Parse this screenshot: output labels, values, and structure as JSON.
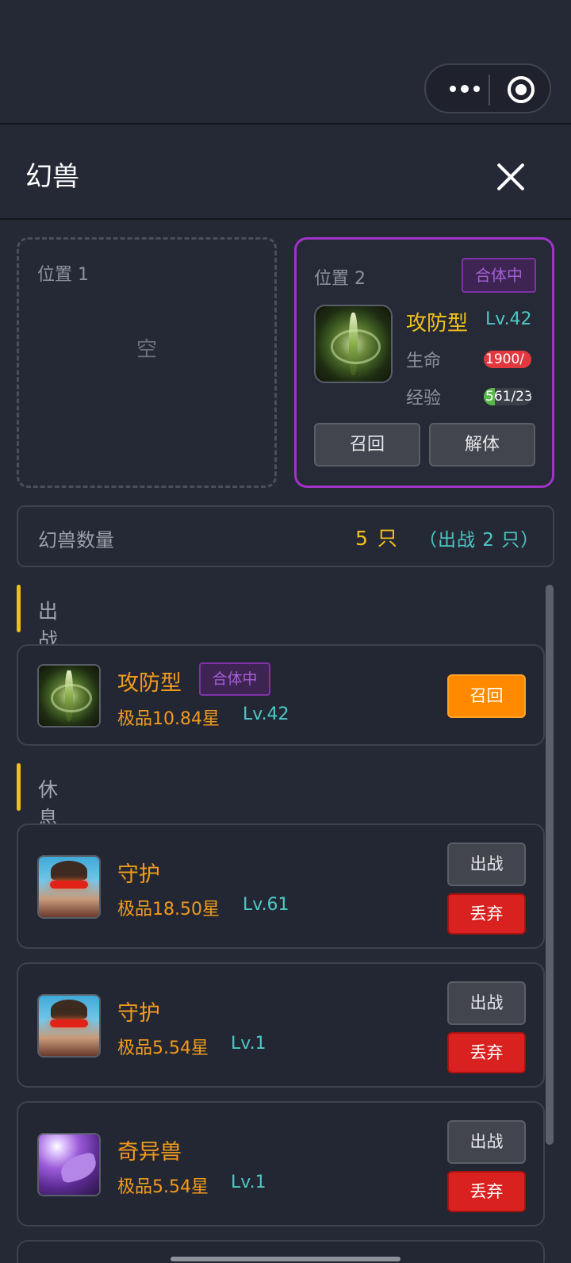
{
  "header": {
    "title": "幻兽"
  },
  "slot1": {
    "label": "位置 1",
    "empty_text": "空"
  },
  "slot2": {
    "label": "位置 2",
    "badge": "合体中",
    "pet_name": "攻防型",
    "level": "Lv.42",
    "hp_label": "生命",
    "hp_text": "1900/",
    "hp_fill": 1.0,
    "exp_label": "经验",
    "exp_text": "561/23",
    "exp_fill": 0.24,
    "recall_label": "召回",
    "unmerge_label": "解体"
  },
  "summary": {
    "label": "幻兽数量",
    "count": "5 只",
    "sub": "（出战 2 只）"
  },
  "sections": {
    "active": "出战中",
    "resting": "休息中"
  },
  "active_pet": {
    "name": "攻防型",
    "badge": "合体中",
    "quality": "极品10.84星",
    "level": "Lv.42",
    "recall_label": "召回"
  },
  "resting_pets": [
    {
      "name": "守护",
      "quality": "极品18.50星",
      "level": "Lv.61",
      "deploy_label": "出战",
      "discard_label": "丢弃"
    },
    {
      "name": "守护",
      "quality": "极品5.54星",
      "level": "Lv.1",
      "deploy_label": "出战",
      "discard_label": "丢弃"
    },
    {
      "name": "奇异兽",
      "quality": "极品5.54星",
      "level": "Lv.1",
      "deploy_label": "出战",
      "discard_label": "丢弃"
    }
  ],
  "colors": {
    "accent_gold": "#f2c21b",
    "accent_cyan": "#4cc8c4",
    "merge_purple": "#a133c9",
    "orange": "#ff8a00",
    "red": "#d9211f"
  },
  "icons": {
    "close": "close-icon",
    "more": "more-dots-icon",
    "capsule_exit": "target-icon"
  }
}
